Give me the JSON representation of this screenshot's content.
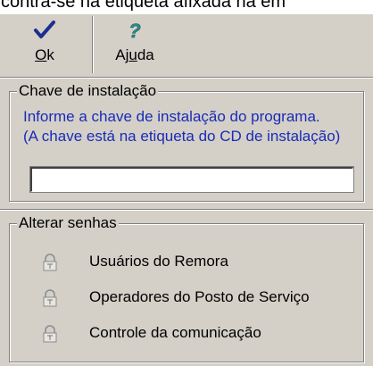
{
  "header_fragment": "contra-se na etiqueta afixada na em",
  "toolbar": {
    "ok_label_underlined": "O",
    "ok_label_rest": "k",
    "help_label_pre": "Aj",
    "help_label_underlined": "u",
    "help_label_post": "da"
  },
  "install_group": {
    "title": "Chave de instalação",
    "info_line1": "Informe a chave de instalação do programa.",
    "info_line2": "(A chave está na etiqueta do CD de instalação)",
    "key_value": ""
  },
  "passwords_group": {
    "title": "Alterar senhas",
    "items": [
      {
        "label": "Usuários do Remora",
        "icon": "lock-icon"
      },
      {
        "label": "Operadores do Posto de Serviço",
        "icon": "lock-icon"
      },
      {
        "label": "Controle da comunicação",
        "icon": "lock-icon"
      }
    ]
  },
  "colors": {
    "window_bg": "#d4d0c8",
    "info_text": "#1a2cb8",
    "checkmark": "#1f2d8f",
    "question": "#2c8c8c"
  }
}
